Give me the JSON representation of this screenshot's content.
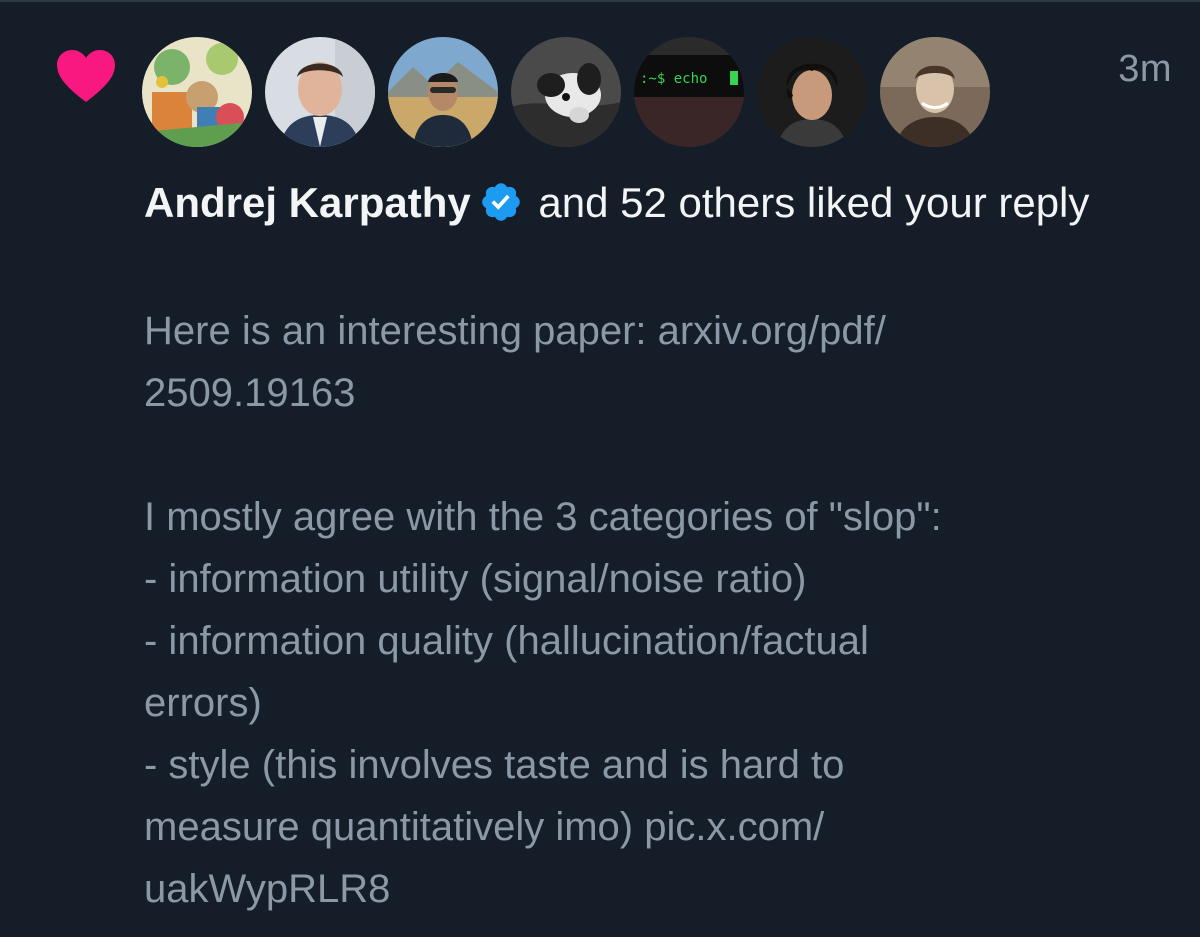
{
  "notification": {
    "type": "like",
    "icon": "heart-icon",
    "accent_color": "#f91880",
    "verified_color": "#1d9bf0",
    "timestamp": "3m",
    "liker_name": "Andrej Karpathy",
    "liker_verified_icon": "verified-badge-icon",
    "summary_text": " and 52 others liked your reply",
    "avatars": [
      {
        "name": "avatar-illustration"
      },
      {
        "name": "avatar-man-suit"
      },
      {
        "name": "avatar-man-outdoors"
      },
      {
        "name": "avatar-dog"
      },
      {
        "name": "avatar-terminal",
        "text": ":~$ echo"
      },
      {
        "name": "avatar-young-man"
      },
      {
        "name": "avatar-man-sepia"
      }
    ],
    "reply_text": "Here is an interesting paper: arxiv.org/pdf/\n2509.19163\n\nI mostly agree with the 3 categories of \"slop\":\n- information utility (signal/noise ratio)\n- information quality (hallucination/factual\nerrors)\n- style (this involves taste and is hard to\nmeasure quantitatively imo) pic.x.com/\nuakWypRLR8"
  }
}
